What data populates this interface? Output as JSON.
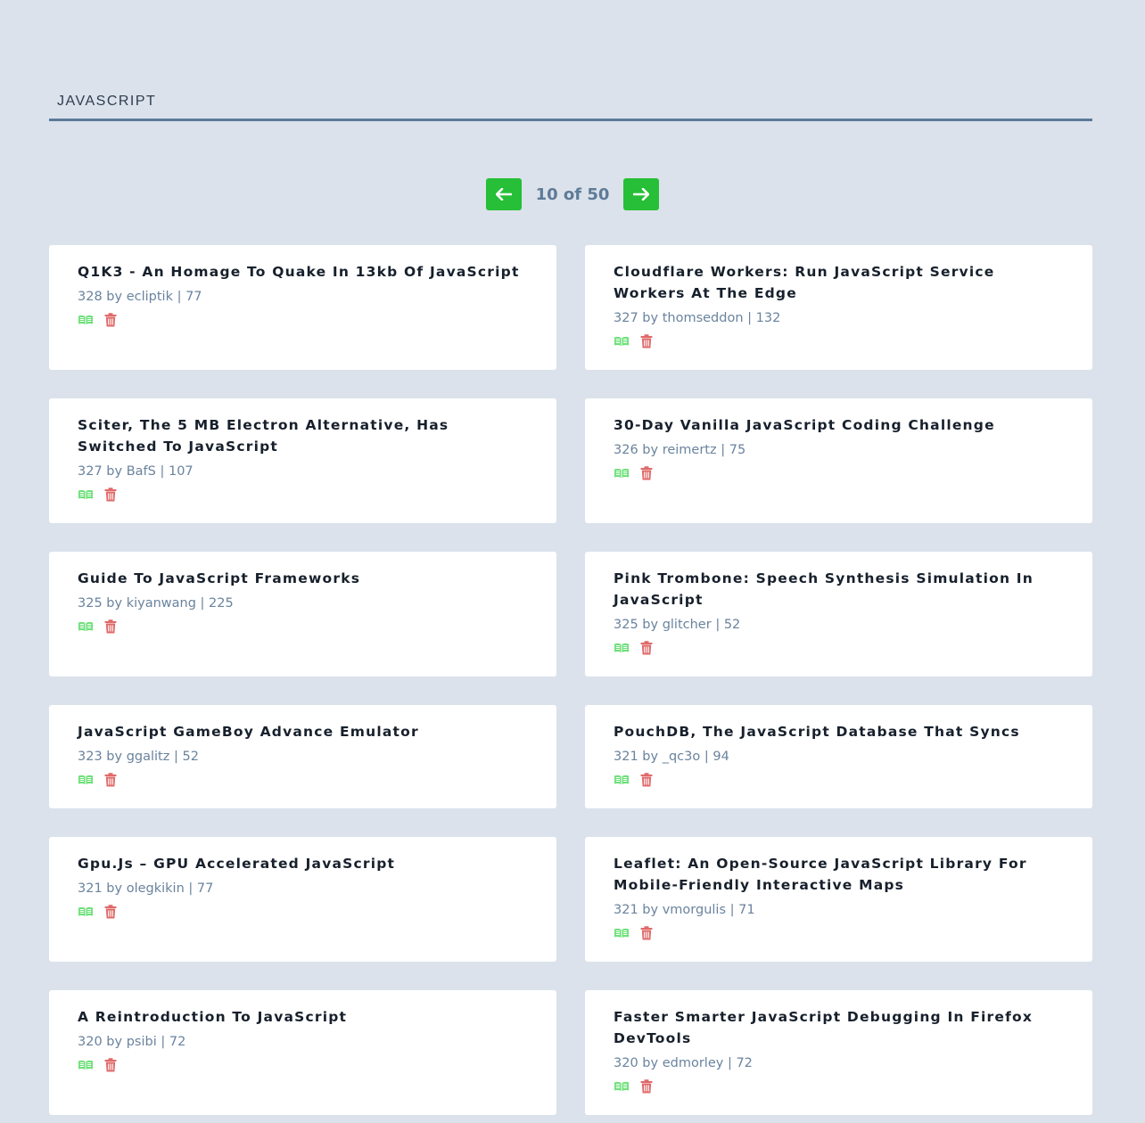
{
  "search": {
    "value": "JAVASCRIPT"
  },
  "pager": {
    "text": "10 of 50"
  },
  "stories": [
    {
      "title": "Q1K3 - An Homage To Quake In 13kb Of JavaScript",
      "points": "328",
      "author": "ecliptik",
      "comments": "77"
    },
    {
      "title": "Cloudflare Workers: Run JavaScript Service Workers At The Edge",
      "points": "327",
      "author": "thomseddon",
      "comments": "132"
    },
    {
      "title": "Sciter, The 5 MB Electron Alternative, Has Switched To JavaScript",
      "points": "327",
      "author": "BafS",
      "comments": "107"
    },
    {
      "title": "30-Day Vanilla JavaScript Coding Challenge",
      "points": "326",
      "author": "reimertz",
      "comments": "75"
    },
    {
      "title": "Guide To JavaScript Frameworks",
      "points": "325",
      "author": "kiyanwang",
      "comments": "225"
    },
    {
      "title": "Pink Trombone: Speech Synthesis Simulation In JavaScript",
      "points": "325",
      "author": "glitcher",
      "comments": "52"
    },
    {
      "title": "JavaScript GameBoy Advance Emulator",
      "points": "323",
      "author": "ggalitz",
      "comments": "52"
    },
    {
      "title": "PouchDB, The JavaScript Database That Syncs",
      "points": "321",
      "author": "_qc3o",
      "comments": "94"
    },
    {
      "title": "Gpu.Js – GPU Accelerated JavaScript",
      "points": "321",
      "author": "olegkikin",
      "comments": "77"
    },
    {
      "title": "Leaflet: An Open-Source JavaScript Library For Mobile-Friendly Interactive Maps",
      "points": "321",
      "author": "vmorgulis",
      "comments": "71"
    },
    {
      "title": "A Reintroduction To JavaScript",
      "points": "320",
      "author": "psibi",
      "comments": "72"
    },
    {
      "title": "Faster Smarter JavaScript Debugging In Firefox DevTools",
      "points": "320",
      "author": "edmorley",
      "comments": "72"
    }
  ],
  "meta_by": "by",
  "meta_sep": "|",
  "icons": {
    "prev": "arrow-left-icon",
    "next": "arrow-right-icon",
    "read": "book-open-icon",
    "remove": "trash-icon"
  },
  "colors": {
    "background": "#dbe2eb",
    "accent": "#26bf37",
    "read_icon": "#6ee07a",
    "remove_icon": "#e06a6a",
    "underline": "#5c7a99"
  }
}
